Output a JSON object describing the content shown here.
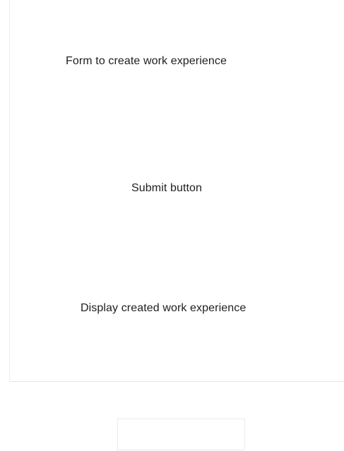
{
  "wireframe": {
    "form_label": "Form to create work experience",
    "submit_label": "Submit button",
    "display_label": "Display created work experience"
  }
}
